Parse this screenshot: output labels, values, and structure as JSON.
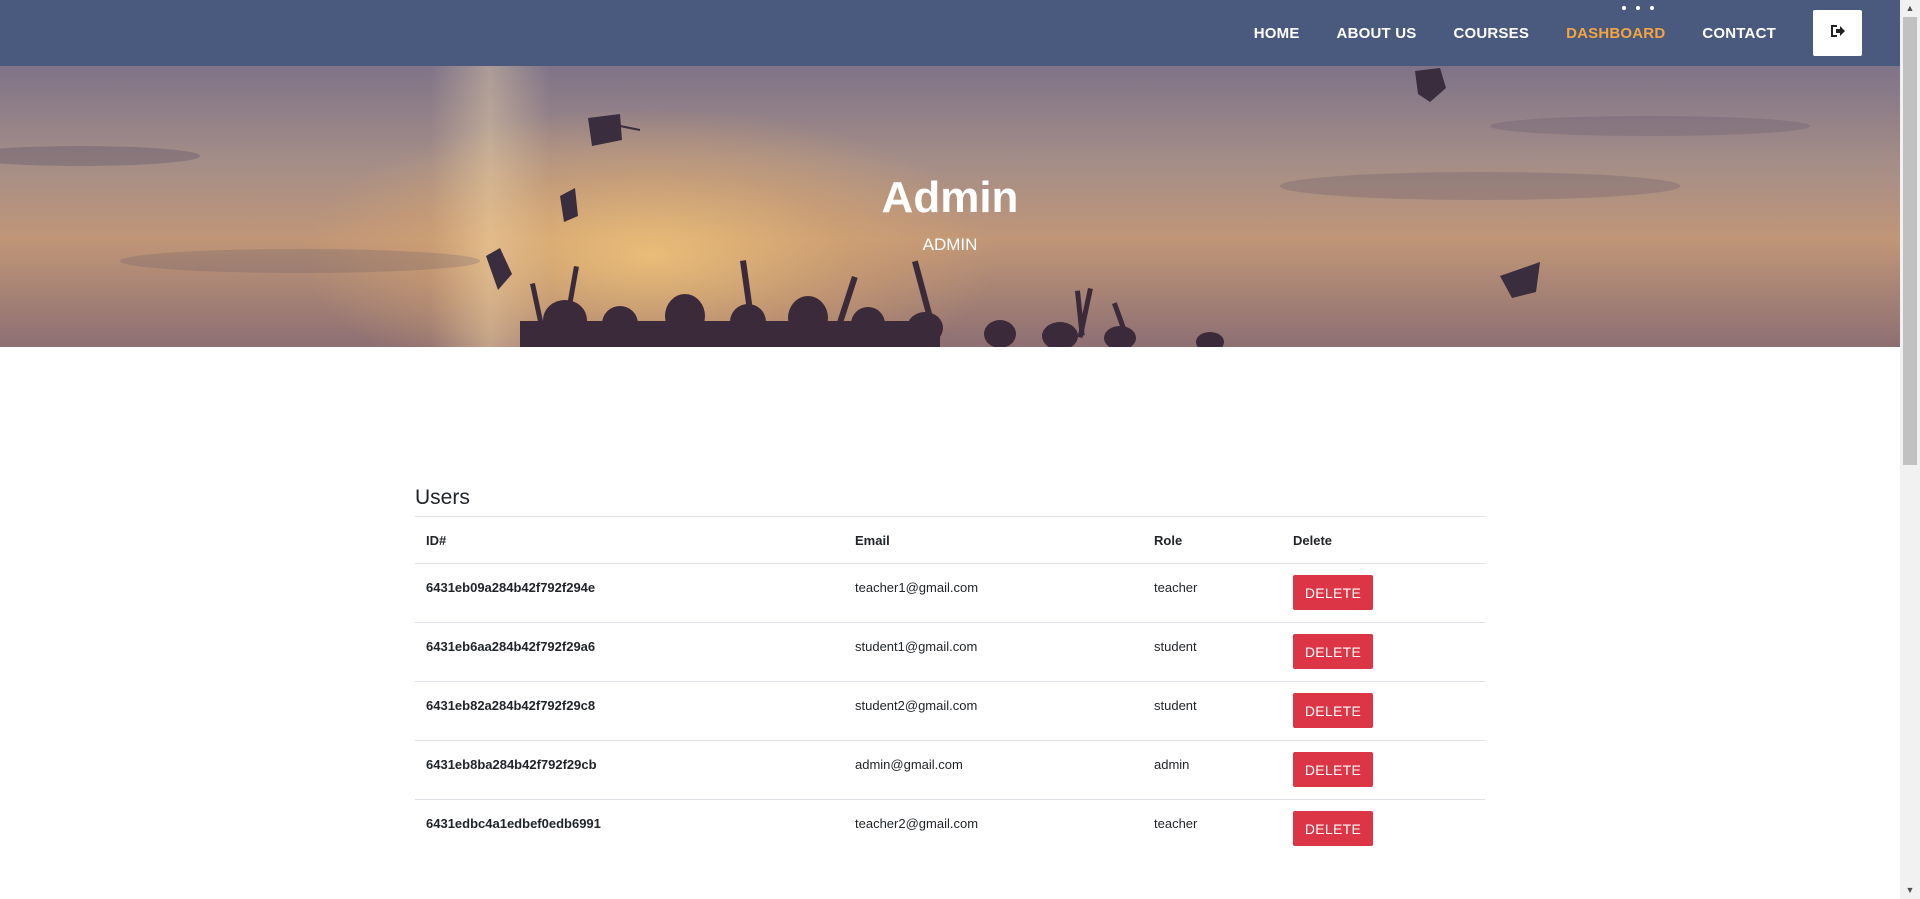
{
  "colors": {
    "navbar": "#4a5a7e",
    "active_link": "#f2a541",
    "delete_button": "#dc3545"
  },
  "nav": {
    "links": [
      {
        "label": "HOME",
        "active": false
      },
      {
        "label": "ABOUT US",
        "active": false
      },
      {
        "label": "COURSES",
        "active": false
      },
      {
        "label": "DASHBOARD",
        "active": true
      },
      {
        "label": "CONTACT",
        "active": false
      }
    ],
    "logout_icon": "sign-out-icon"
  },
  "hero": {
    "title": "Admin",
    "subtitle": "ADMIN",
    "background": "graduation-caps-sunset-photo"
  },
  "users": {
    "title": "Users",
    "columns": [
      "ID#",
      "Email",
      "Role",
      "Delete"
    ],
    "rows": [
      {
        "id": "6431eb09a284b42f792f294e",
        "email": "teacher1@gmail.com",
        "role": "teacher",
        "action": "DELETE"
      },
      {
        "id": "6431eb6aa284b42f792f29a6",
        "email": "student1@gmail.com",
        "role": "student",
        "action": "DELETE"
      },
      {
        "id": "6431eb82a284b42f792f29c8",
        "email": "student2@gmail.com",
        "role": "student",
        "action": "DELETE"
      },
      {
        "id": "6431eb8ba284b42f792f29cb",
        "email": "admin@gmail.com",
        "role": "admin",
        "action": "DELETE"
      },
      {
        "id": "6431edbc4a1edbef0edb6991",
        "email": "teacher2@gmail.com",
        "role": "teacher",
        "action": "DELETE"
      }
    ]
  }
}
